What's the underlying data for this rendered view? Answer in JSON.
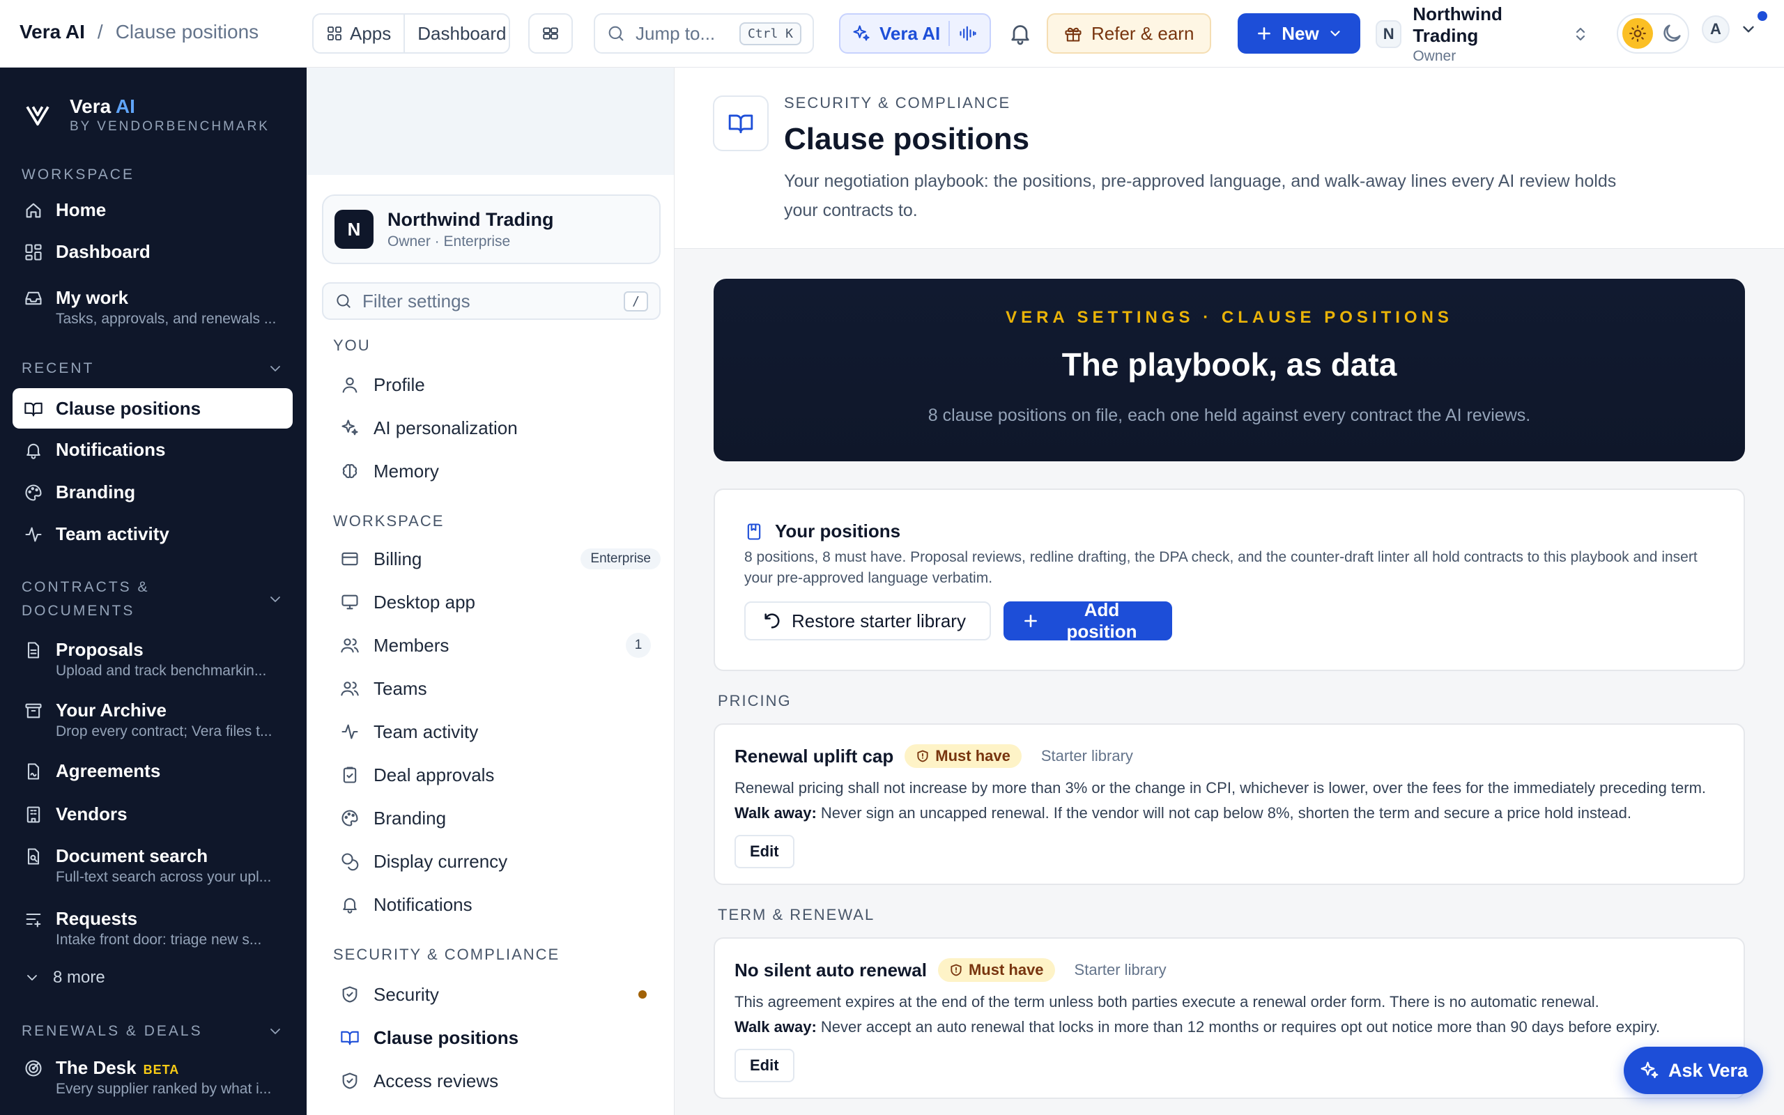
{
  "topbar": {
    "app_name": "Vera AI",
    "separator": "/",
    "current_page": "Clause positions",
    "apps_label": "Apps",
    "dashboard_label": "Dashboard",
    "jump_placeholder": "Jump to...",
    "jump_shortcut": "Ctrl K",
    "vera_label": "Vera AI",
    "refer_label": "Refer & earn",
    "new_label": "New",
    "org_initial": "N",
    "org_name": "Northwind Trading",
    "org_role": "Owner",
    "user_initial": "A"
  },
  "leftnav": {
    "brand_name": "Vera",
    "brand_ai": "AI",
    "brand_by": "BY VENDORBENCHMARK",
    "sections": {
      "workspace": "WORKSPACE",
      "recent": "RECENT",
      "contracts": "CONTRACTS &",
      "contracts2": "DOCUMENTS",
      "renewals": "RENEWALS & DEALS"
    },
    "items": {
      "home": "Home",
      "dashboard": "Dashboard",
      "mywork": "My work",
      "mywork_sub": "Tasks, approvals, and renewals ...",
      "clause": "Clause positions",
      "notifications": "Notifications",
      "branding": "Branding",
      "teamactivity": "Team activity",
      "proposals": "Proposals",
      "proposals_sub": "Upload and track benchmarkin...",
      "archive": "Your Archive",
      "archive_sub": "Drop every contract; Vera files t...",
      "agreements": "Agreements",
      "vendors": "Vendors",
      "docsearch": "Document search",
      "docsearch_sub": "Full-text search across your upl...",
      "requests": "Requests",
      "requests_sub": "Intake front door: triage new s...",
      "more": "8 more",
      "desk": "The Desk",
      "desk_badge": "BETA",
      "desk_sub": "Every supplier ranked by what i..."
    }
  },
  "settings": {
    "org_initial": "N",
    "org_name": "Northwind Trading",
    "org_plan": "Owner · Enterprise",
    "filter_placeholder": "Filter settings",
    "filter_shortcut": "/",
    "sec_you": "YOU",
    "sec_workspace": "WORKSPACE",
    "sec_security": "SECURITY & COMPLIANCE",
    "profile": "Profile",
    "ai_personalization": "AI personalization",
    "memory": "Memory",
    "billing": "Billing",
    "billing_badge": "Enterprise",
    "desktop": "Desktop app",
    "members": "Members",
    "members_count": "1",
    "teams": "Teams",
    "team_activity": "Team activity",
    "deal_approvals": "Deal approvals",
    "branding": "Branding",
    "currency": "Display currency",
    "notifications": "Notifications",
    "security": "Security",
    "clause_positions": "Clause positions",
    "access_reviews": "Access reviews"
  },
  "page": {
    "eyebrow": "SECURITY & COMPLIANCE",
    "title": "Clause positions",
    "description": "Your negotiation playbook: the positions, pre-approved language, and walk-away lines every AI review holds your contracts to.",
    "hero_kicker": "VERA SETTINGS · CLAUSE POSITIONS",
    "hero_title": "The playbook, as data",
    "hero_sub": "8 clause positions on file, each one held against every contract the AI reviews.",
    "yours_title": "Your positions",
    "yours_desc": "8 positions, 8 must have. Proposal reviews, redline drafting, the DPA check, and the counter-draft linter all hold contracts to this playbook and insert your pre-approved language verbatim.",
    "restore_label": "Restore starter library",
    "add_label": "Add position",
    "groups": [
      {
        "name": "PRICING",
        "title": "Renewal uplift cap",
        "badge": "Must have",
        "source": "Starter library",
        "body": "Renewal pricing shall not increase by more than 3% or the change in CPI, whichever is lower, over the fees for the immediately preceding term.",
        "walk_label": "Walk away:",
        "walk": "Never sign an uncapped renewal. If the vendor will not cap below 8%, shorten the term and secure a price hold instead.",
        "edit": "Edit"
      },
      {
        "name": "TERM & RENEWAL",
        "title": "No silent auto renewal",
        "badge": "Must have",
        "source": "Starter library",
        "body": "This agreement expires at the end of the term unless both parties execute a renewal order form. There is no automatic renewal.",
        "walk_label": "Walk away:",
        "walk": "Never accept an auto renewal that locks in more than 12 months or requires opt out notice more than 90 days before expiry.",
        "edit": "Edit"
      }
    ],
    "ask_label": "Ask Vera"
  },
  "colors": {
    "accent": "#1d4ed8",
    "nav_bg": "#0f172a",
    "must_have_bg": "#fef3c7",
    "hero_kicker": "#eab308"
  }
}
